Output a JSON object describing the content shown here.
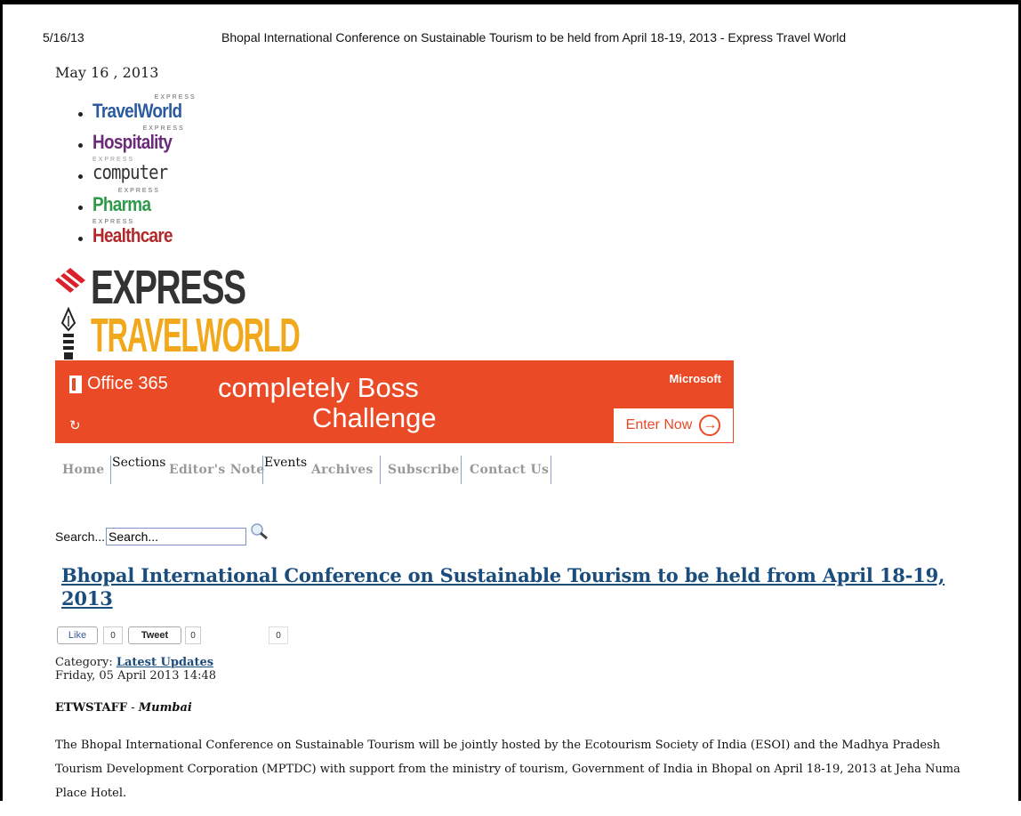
{
  "print_header": {
    "date": "5/16/13",
    "title": "Bhopal International Conference on Sustainable Tourism to be held from April 18-19, 2013 - Express Travel World"
  },
  "page_date": "May 16 , 2013",
  "publications": [
    {
      "tag": "EXPRESS",
      "name": "TravelWorld",
      "color": "#2b5aa0",
      "style": "default"
    },
    {
      "tag": "EXPRESS",
      "name": "Hospitality",
      "color": "#6b2a7a",
      "style": "default"
    },
    {
      "tag": "EXPRESS",
      "name": "computer",
      "color": "#333333",
      "style": "computer"
    },
    {
      "tag": "EXPRESS",
      "name": "Pharma",
      "color": "#2e9a4a",
      "style": "default"
    },
    {
      "tag": "EXPRESS",
      "name": "Healthcare",
      "color": "#b0282a",
      "style": "default"
    }
  ],
  "brand": {
    "line1": "EXPRESS",
    "line2": "TRAVELWORLD",
    "colors": {
      "line1": "#333333",
      "line2": "#f2a81d",
      "kite": "#d9222a"
    }
  },
  "ad": {
    "product": "Office 365",
    "headline_line1": "completely Boss",
    "headline_line2": "Challenge",
    "vendor": "Microsoft",
    "cta": "Enter Now",
    "refresh_icon": "↻",
    "background": "#eb4a27"
  },
  "nav": {
    "home": "Home",
    "sections": "Sections",
    "editors_note": "Editor's Note",
    "events": "Events",
    "archives": "Archives",
    "subscribe": "Subscribe",
    "contact": "Contact Us"
  },
  "search": {
    "label": "Search...",
    "value": "Search..."
  },
  "article": {
    "title": "Bhopal International Conference on Sustainable Tourism to be held from April 18-19, 2013",
    "social": {
      "like_label": "Like",
      "like_count": "0",
      "tweet_label": "Tweet",
      "tweet_count": "0",
      "share_count": "0"
    },
    "category_label": "Category:",
    "category": "Latest Updates",
    "datetime": "Friday, 05 April 2013 14:48",
    "author": "ETWSTAFF",
    "author_sep": " - ",
    "location": "Mumbai",
    "paragraphs": [
      "The Bhopal International Conference on Sustainable Tourism will be jointly hosted by the Ecotourism Society of India (ESOI) and the Madhya Pradesh Tourism Development Corporation (MPTDC) with support from the ministry of tourism, Government of India in Bhopal on April 18-19, 2013 at Jeha Numa Place Hotel."
    ]
  }
}
